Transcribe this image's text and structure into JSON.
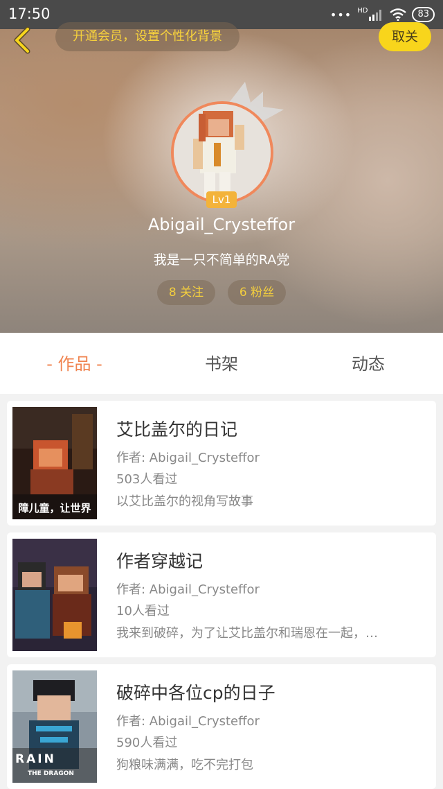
{
  "status_bar": {
    "time": "17:50",
    "network_label": "HD",
    "battery": "83",
    "icons": [
      "more-dots-icon",
      "signal-icon",
      "wifi-icon",
      "battery-icon"
    ]
  },
  "header": {
    "back_icon": "chevron-left-icon",
    "member_prompt": "开通会员，设置个性化背景",
    "unfollow_label": "取关",
    "level": "Lv1",
    "username": "Abigail_Crysteffor",
    "bio": "我是一只不简单的RA党",
    "following_label": "8 关注",
    "fans_label": "6 粉丝",
    "colors": {
      "accent_yellow": "#f8d51c",
      "avatar_ring": "#f0885b",
      "level_badge": "#f3b33a"
    }
  },
  "tabs": {
    "works": "- 作品 -",
    "shelf": "书架",
    "feed": "动态",
    "active_color": "#f08450"
  },
  "works": [
    {
      "title": "艾比盖尔的日记",
      "author": "作者: Abigail_Crysteffor",
      "views": "503人看过",
      "desc": "以艾比盖尔的视角写故事",
      "cover_caption": "障儿童，让世界"
    },
    {
      "title": "作者穿越记",
      "author": "作者: Abigail_Crysteffor",
      "views": "10人看过",
      "desc": "我来到破碎，为了让艾比盖尔和瑞恩在一起，…"
    },
    {
      "title": "破碎中各位cp的日子",
      "author": "作者: Abigail_Crysteffor",
      "views": "590人看过",
      "desc": "狗粮味满满，吃不完打包",
      "cover_caption": "RAIN",
      "cover_subcaption": "THE DRAGON"
    }
  ]
}
